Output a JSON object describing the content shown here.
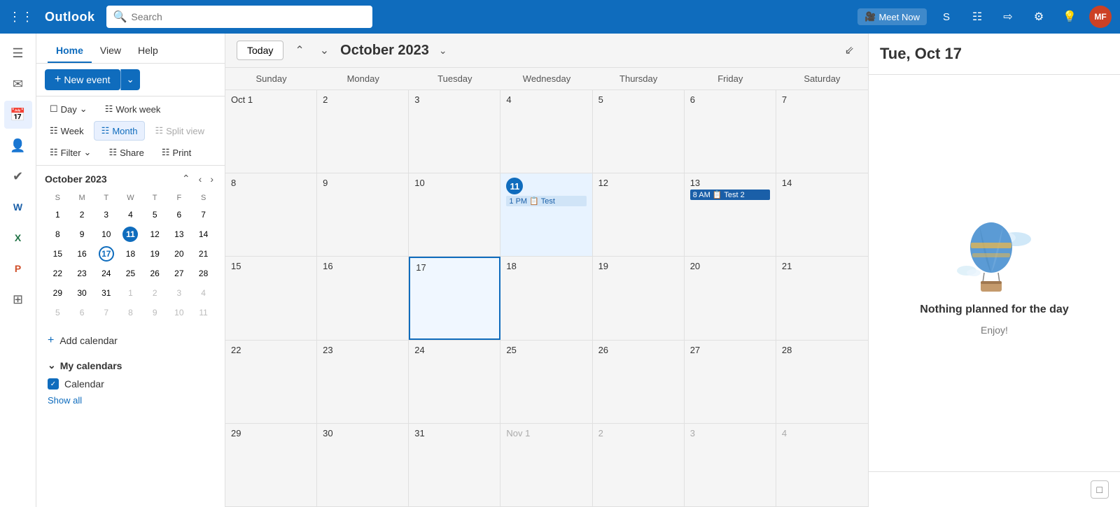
{
  "app": {
    "name": "Outlook",
    "avatar_initials": "MF"
  },
  "search": {
    "placeholder": "Search"
  },
  "topbar": {
    "meet_now_label": "Meet Now",
    "icons": [
      "video-icon",
      "skype-icon",
      "apps-icon",
      "share-icon",
      "settings-icon",
      "lightbulb-icon"
    ]
  },
  "toolbar": {
    "new_event_label": "New event",
    "day_label": "Day",
    "work_week_label": "Work week",
    "week_label": "Week",
    "month_label": "Month",
    "split_view_label": "Split view",
    "filter_label": "Filter",
    "share_label": "Share",
    "print_label": "Print"
  },
  "nav_tabs": {
    "home_label": "Home",
    "view_label": "View",
    "help_label": "Help"
  },
  "mini_calendar": {
    "title": "October 2023",
    "days_of_week": [
      "S",
      "M",
      "T",
      "W",
      "T",
      "F",
      "S"
    ],
    "weeks": [
      [
        {
          "day": 1,
          "other": false
        },
        {
          "day": 2,
          "other": false
        },
        {
          "day": 3,
          "other": false
        },
        {
          "day": 4,
          "other": false
        },
        {
          "day": 5,
          "other": false
        },
        {
          "day": 6,
          "other": false
        },
        {
          "day": 7,
          "other": false
        }
      ],
      [
        {
          "day": 8,
          "other": false
        },
        {
          "day": 9,
          "other": false
        },
        {
          "day": 10,
          "other": false
        },
        {
          "day": 11,
          "today": true
        },
        {
          "day": 12,
          "other": false
        },
        {
          "day": 13,
          "other": false
        },
        {
          "day": 14,
          "other": false
        }
      ],
      [
        {
          "day": 15,
          "other": false
        },
        {
          "day": 16,
          "other": false
        },
        {
          "day": 17,
          "selected": true
        },
        {
          "day": 18,
          "other": false
        },
        {
          "day": 19,
          "other": false
        },
        {
          "day": 20,
          "other": false
        },
        {
          "day": 21,
          "other": false
        }
      ],
      [
        {
          "day": 22,
          "other": false
        },
        {
          "day": 23,
          "other": false
        },
        {
          "day": 24,
          "other": false
        },
        {
          "day": 25,
          "other": false
        },
        {
          "day": 26,
          "other": false
        },
        {
          "day": 27,
          "other": false
        },
        {
          "day": 28,
          "other": false
        }
      ],
      [
        {
          "day": 29,
          "other": false
        },
        {
          "day": 30,
          "other": false
        },
        {
          "day": 31,
          "other": false
        },
        {
          "day": 1,
          "other": true
        },
        {
          "day": 2,
          "other": true
        },
        {
          "day": 3,
          "other": true
        },
        {
          "day": 4,
          "other": true
        }
      ],
      [
        {
          "day": 5,
          "other": true
        },
        {
          "day": 6,
          "other": true
        },
        {
          "day": 7,
          "other": true
        },
        {
          "day": 8,
          "other": true
        },
        {
          "day": 9,
          "other": true
        },
        {
          "day": 10,
          "other": true
        },
        {
          "day": 11,
          "other": true
        }
      ]
    ]
  },
  "add_calendar_label": "Add calendar",
  "my_calendars": {
    "section_label": "My calendars",
    "items": [
      {
        "label": "Calendar",
        "checked": true
      }
    ],
    "show_all_label": "Show all"
  },
  "calendar_view": {
    "today_label": "Today",
    "month_title": "October 2023",
    "days_of_week": [
      "Sunday",
      "Monday",
      "Tuesday",
      "Wednesday",
      "Thursday",
      "Friday",
      "Saturday"
    ],
    "weeks": [
      {
        "cells": [
          {
            "date": "Oct 1",
            "is_other": false,
            "events": []
          },
          {
            "date": "2",
            "is_other": false,
            "events": []
          },
          {
            "date": "3",
            "is_other": false,
            "events": []
          },
          {
            "date": "4",
            "is_other": false,
            "events": []
          },
          {
            "date": "5",
            "is_other": false,
            "events": []
          },
          {
            "date": "6",
            "is_other": false,
            "events": []
          },
          {
            "date": "7",
            "is_other": false,
            "events": []
          }
        ]
      },
      {
        "cells": [
          {
            "date": "8",
            "is_other": false,
            "events": []
          },
          {
            "date": "9",
            "is_other": false,
            "events": []
          },
          {
            "date": "10",
            "is_other": false,
            "events": []
          },
          {
            "date": "11",
            "is_today": true,
            "events": [
              {
                "label": "1 PM 📋 Test",
                "type": "blue"
              }
            ]
          },
          {
            "date": "12",
            "is_other": false,
            "events": []
          },
          {
            "date": "13",
            "is_other": false,
            "events": [
              {
                "label": "8 AM 📋 Test 2",
                "type": "blue-dark"
              }
            ]
          },
          {
            "date": "14",
            "is_other": false,
            "events": []
          }
        ]
      },
      {
        "cells": [
          {
            "date": "15",
            "is_other": false,
            "events": []
          },
          {
            "date": "16",
            "is_other": false,
            "events": []
          },
          {
            "date": "17",
            "is_selected": true,
            "events": []
          },
          {
            "date": "18",
            "is_other": false,
            "events": []
          },
          {
            "date": "19",
            "is_other": false,
            "events": []
          },
          {
            "date": "20",
            "is_other": false,
            "events": []
          },
          {
            "date": "21",
            "is_other": false,
            "events": []
          }
        ]
      },
      {
        "cells": [
          {
            "date": "22",
            "is_other": false,
            "events": []
          },
          {
            "date": "23",
            "is_other": false,
            "events": []
          },
          {
            "date": "24",
            "is_other": false,
            "events": []
          },
          {
            "date": "25",
            "is_other": false,
            "events": []
          },
          {
            "date": "26",
            "is_other": false,
            "events": []
          },
          {
            "date": "27",
            "is_other": false,
            "events": []
          },
          {
            "date": "28",
            "is_other": false,
            "events": []
          }
        ]
      },
      {
        "cells": [
          {
            "date": "29",
            "is_other": false,
            "events": []
          },
          {
            "date": "30",
            "is_other": false,
            "events": []
          },
          {
            "date": "31",
            "is_other": false,
            "events": []
          },
          {
            "date": "Nov 1",
            "is_other": true,
            "events": []
          },
          {
            "date": "2",
            "is_other": true,
            "events": []
          },
          {
            "date": "3",
            "is_other": true,
            "events": []
          },
          {
            "date": "4",
            "is_other": true,
            "events": []
          }
        ]
      }
    ]
  },
  "right_panel": {
    "date_label": "Tue, Oct 17",
    "nothing_planned_label": "Nothing planned for the day",
    "enjoy_label": "Enjoy!"
  },
  "sidebar_icons": [
    {
      "name": "menu-icon",
      "symbol": "☰"
    },
    {
      "name": "mail-icon",
      "symbol": "✉"
    },
    {
      "name": "calendar-icon",
      "symbol": "📅"
    },
    {
      "name": "contacts-icon",
      "symbol": "👤"
    },
    {
      "name": "tasks-icon",
      "symbol": "✔"
    },
    {
      "name": "word-icon",
      "symbol": "W"
    },
    {
      "name": "excel-icon",
      "symbol": "X"
    },
    {
      "name": "powerpoint-icon",
      "symbol": "P"
    },
    {
      "name": "apps-icon",
      "symbol": "⊞"
    }
  ]
}
